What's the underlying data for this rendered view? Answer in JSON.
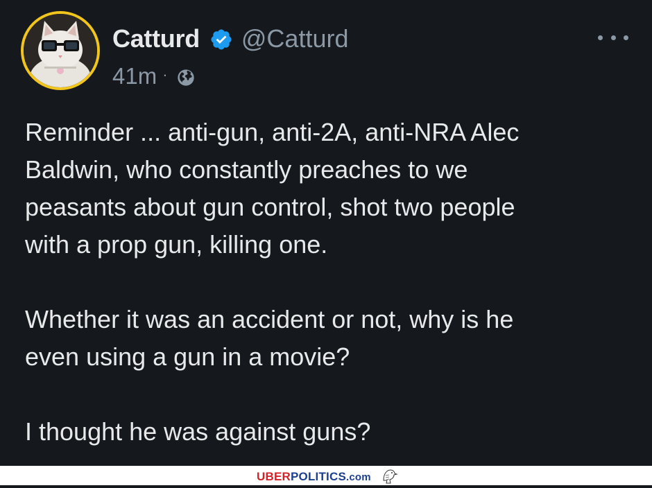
{
  "tweet": {
    "display_name": "Catturd",
    "handle": "@Catturd",
    "time": "41m",
    "separator": "·",
    "verified_icon": "verified-badge-icon",
    "audience_icon": "globe-icon",
    "paragraphs": [
      "Reminder ... anti-gun, anti-2A, anti-NRA Alec\nBaldwin, who constantly preaches to we\npeasants about gun control, shot two people\nwith a prop gun, killing one.",
      "Whether it was an accident or not, why is he\neven using a gun in a movie?",
      "I thought he was against guns?"
    ]
  },
  "watermark": {
    "part1": "UBER",
    "part2": "POLITICS",
    "part3": ".com"
  },
  "colors": {
    "background": "#15181c",
    "text": "#e7e9ea",
    "secondary_text": "#8b98a5",
    "verified": "#1d9bf0",
    "avatar_ring": "#f2c51c",
    "watermark_red": "#d2232a",
    "watermark_blue": "#1d3f8f"
  }
}
